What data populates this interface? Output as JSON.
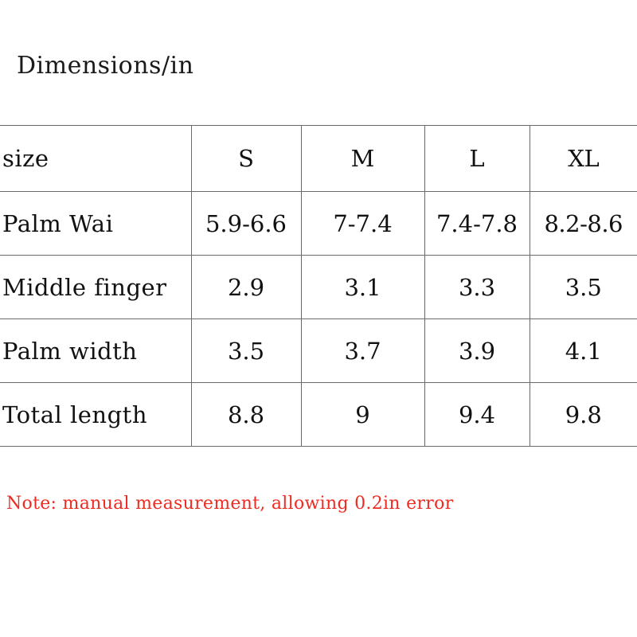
{
  "page": {
    "title": "Dimensions/in",
    "background_color": "#ffffff",
    "text_color": "#111111",
    "border_color": "#6a6a6a",
    "note_color": "#ee2b22"
  },
  "table": {
    "headers": {
      "label": "size",
      "s": "S",
      "m": "M",
      "l": "L",
      "xl": "XL"
    },
    "rows": [
      {
        "label": "Palm Wai",
        "s": "5.9-6.6",
        "m": "7-7.4",
        "l": "7.4-7.8",
        "xl": "8.2-8.6"
      },
      {
        "label": "Middle finger",
        "s": "2.9",
        "m": "3.1",
        "l": "3.3",
        "xl": "3.5"
      },
      {
        "label": "Palm width",
        "s": "3.5",
        "m": "3.7",
        "l": "3.9",
        "xl": "4.1"
      },
      {
        "label": "Total length",
        "s": "8.8",
        "m": "9",
        "l": "9.4",
        "xl": "9.8"
      }
    ]
  },
  "note": {
    "text": "Note: manual measurement, allowing 0.2in error"
  }
}
